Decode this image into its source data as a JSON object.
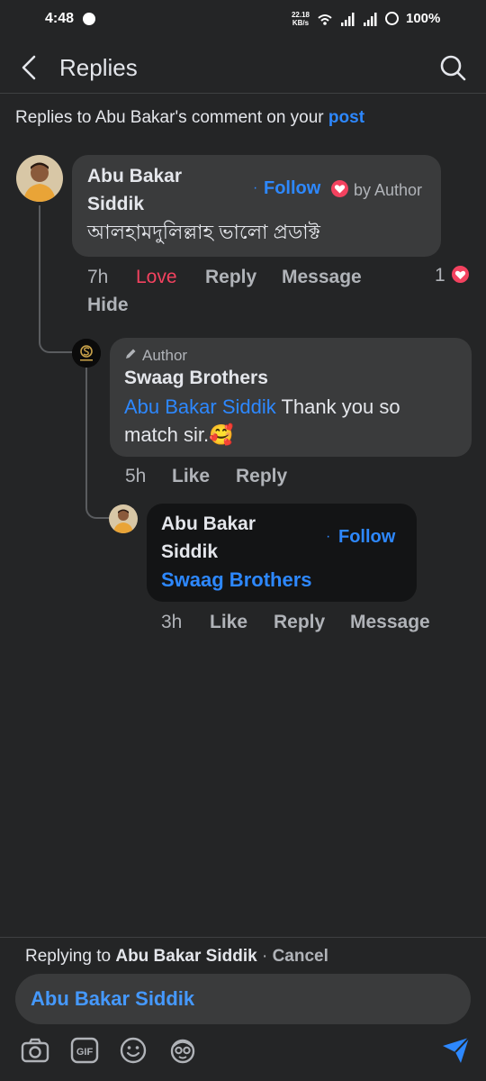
{
  "status": {
    "time": "4:48",
    "speed_value": "22.18",
    "speed_unit": "KB/s",
    "battery": "100%"
  },
  "header": {
    "title": "Replies"
  },
  "context": {
    "prefix": "Replies to Abu Bakar's comment on your",
    "link": "post"
  },
  "comments": [
    {
      "name_line1": "Abu Bakar",
      "name_line2": "Siddik",
      "follow": "Follow",
      "by_author": "by Author",
      "text": "আলহামদুলিল্লাহ ভালো প্রডাক্ট",
      "time": "7h",
      "reaction": "Love",
      "reply": "Reply",
      "message": "Message",
      "hide": "Hide",
      "reaction_count": "1"
    },
    {
      "badge": "Author",
      "name": "Swaag Brothers",
      "mention": "Abu Bakar Siddik",
      "text_line1": "Thank you so",
      "text_line2": "match sir.🥰",
      "time": "5h",
      "like": "Like",
      "reply": "Reply"
    },
    {
      "name_line1": "Abu Bakar",
      "name_line2": "Siddik",
      "follow": "Follow",
      "mention": "Swaag Brothers",
      "time": "3h",
      "like": "Like",
      "reply": "Reply",
      "message": "Message"
    }
  ],
  "footer": {
    "replying_prefix": "Replying to",
    "replying_name": "Abu Bakar Siddik",
    "cancel": "Cancel",
    "input_value": "Abu Bakar Siddik"
  },
  "colors": {
    "background": "#242526",
    "bubble": "#3a3b3c",
    "accent": "#2d88ff",
    "love": "#f3425f"
  }
}
